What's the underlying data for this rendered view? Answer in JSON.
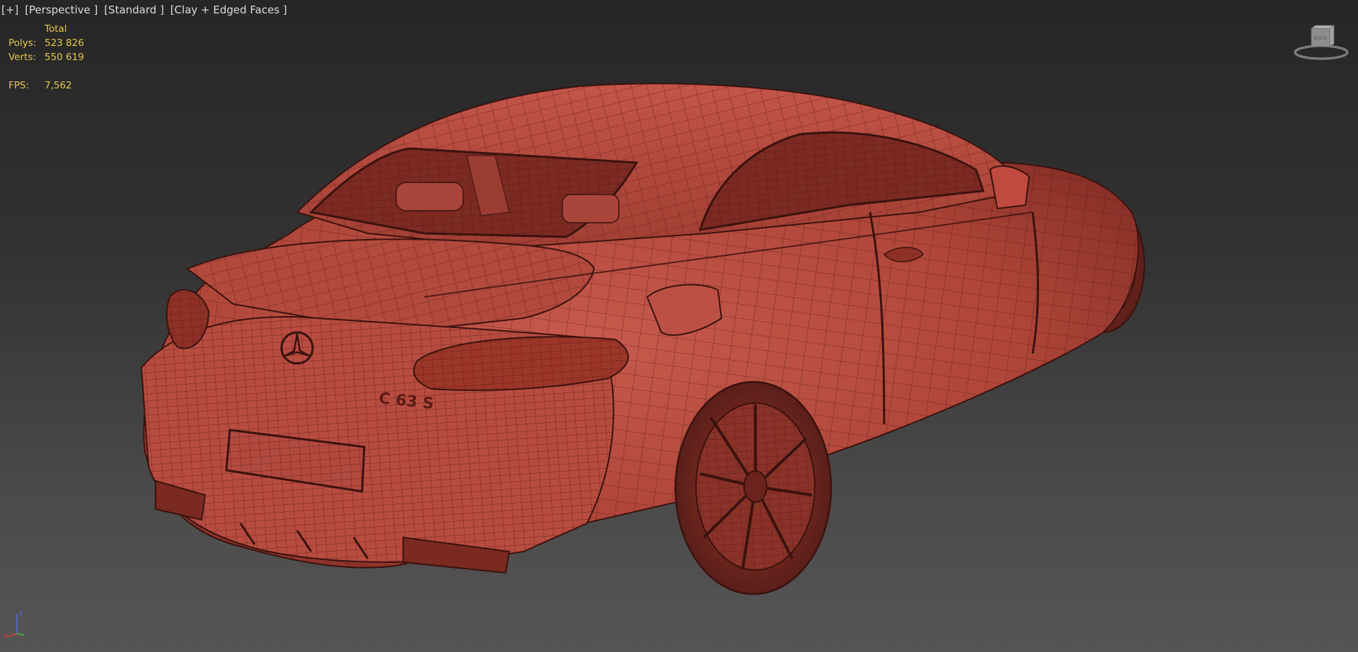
{
  "viewport": {
    "labels": [
      "[+]",
      "[Perspective ]",
      "[Standard ]",
      "[Clay + Edged Faces ]"
    ]
  },
  "stats": {
    "header": "Total",
    "polys_label": "Polys:",
    "polys_value": "523 826",
    "verts_label": "Verts:",
    "verts_value": "550 619",
    "fps_label": "FPS:",
    "fps_value": "7,562"
  },
  "viewcube": {
    "face_label": "BACK"
  },
  "model": {
    "badge_text": "C 63 S"
  },
  "axis": {
    "z_label": "z",
    "x_label": "x"
  },
  "colors": {
    "clay": "#b8453a",
    "clay_dark": "#8e2f27",
    "wire": "#4a1712",
    "stats_text": "#e6c84a"
  }
}
